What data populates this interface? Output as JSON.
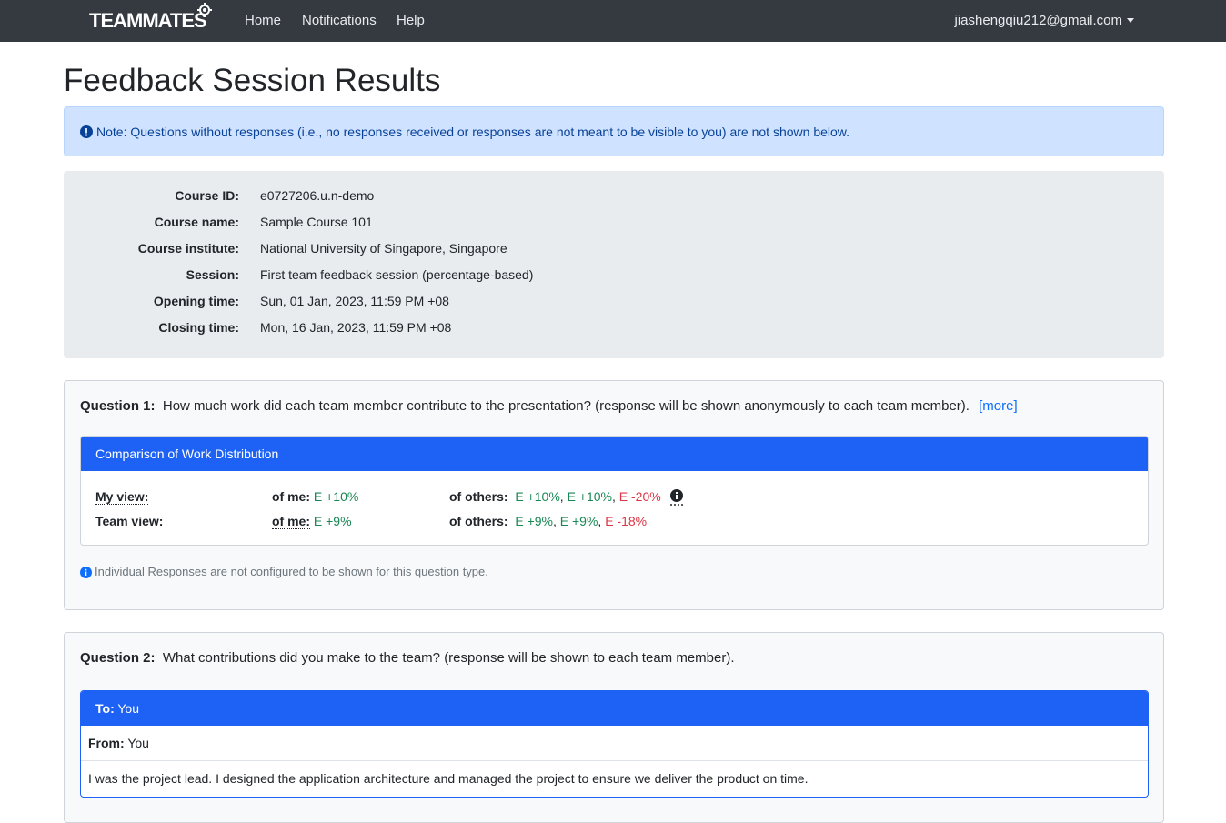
{
  "nav": {
    "brand": "TEAMMATES",
    "links": [
      "Home",
      "Notifications",
      "Help"
    ],
    "user": "jiashengqiu212@gmail.com"
  },
  "page_title": "Feedback Session Results",
  "note": "Note: Questions without responses (i.e., no responses received or responses are not meant to be visible to you) are not shown below.",
  "session_info": [
    {
      "label": "Course ID:",
      "value": "e0727206.u.n-demo"
    },
    {
      "label": "Course name:",
      "value": "Sample Course 101"
    },
    {
      "label": "Course institute:",
      "value": "National University of Singapore, Singapore"
    },
    {
      "label": "Session:",
      "value": "First team feedback session (percentage-based)"
    },
    {
      "label": "Opening time:",
      "value": "Sun, 01 Jan, 2023, 11:59 PM +08"
    },
    {
      "label": "Closing time:",
      "value": "Mon, 16 Jan, 2023, 11:59 PM +08"
    }
  ],
  "question1": {
    "label": "Question 1:",
    "text": "How much work did each team member contribute to the presentation? (response will be shown anonymously to each team member).",
    "more": "[more]",
    "card_title": "Comparison of Work Distribution",
    "my_view": {
      "label": "My view:",
      "of_me_label": "of me:",
      "of_me": "E +10%",
      "of_others_label": "of others:",
      "others": [
        "E +10%",
        "E +10%",
        "E -20%"
      ],
      "sep": ","
    },
    "team_view": {
      "label": "Team view:",
      "of_me_label": "of me:",
      "of_me": "E +9%",
      "of_others_label": "of others:",
      "others": [
        "E +9%",
        "E +9%",
        "E -18%"
      ]
    },
    "hint": "Individual Responses are not configured to be shown for this question type."
  },
  "question2": {
    "label": "Question 2:",
    "text": "What contributions did you make to the team? (response will be shown to each team member).",
    "to_label": "To:",
    "to_value": "You",
    "from_label": "From:",
    "from_value": "You",
    "response": "I was the project lead. I designed the application architecture and managed the project to ensure we deliver the product on time."
  },
  "colors": {
    "navbar": "#343a40",
    "primary": "#1e62f5",
    "note_bg": "#cfe2ff",
    "positive": "#198754",
    "negative": "#dc3545"
  }
}
